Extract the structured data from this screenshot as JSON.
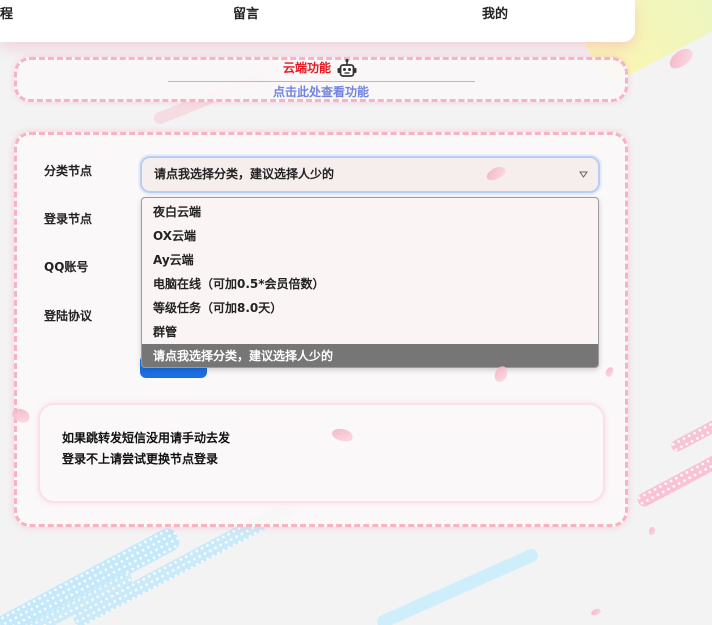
{
  "nav": {
    "items": [
      {
        "label": "程"
      },
      {
        "label": "留言"
      },
      {
        "label": "我的"
      }
    ]
  },
  "cloud_panel": {
    "title": "云端功能",
    "title_icon": "robot-icon",
    "link": "点击此处查看功能"
  },
  "login_form": {
    "labels": {
      "category": "分类节点",
      "node": "登录节点",
      "qq": "QQ账号",
      "protocol": "登陆协议"
    },
    "category_select": {
      "value": "请点我选择分类，建议选择人少的",
      "arrow_icon": "chevron-down-icon",
      "expanded": true,
      "options": [
        "夜白云端",
        "OX云端",
        "Ay云端",
        "电脑在线（可加0.5*会员倍数）",
        "等级任务（可加8.0天）",
        "群管",
        "请点我选择分类，建议选择人少的"
      ],
      "highlighted_index": 6
    }
  },
  "notice": {
    "lines": [
      "如果跳转发短信没用请手动去发",
      "登录不上请尝试更换节点登录"
    ]
  },
  "colors": {
    "title_red": "#e8161e",
    "link_blue": "#7284e0",
    "dashed_border": "#f5b3c3",
    "select_border": "#b7cdf4",
    "select_bg": "#f6eded",
    "dropdown_bg": "#fbf4f4",
    "option_highlight": "#767676",
    "button_blue": "#1c6fe3",
    "text": "#222222"
  }
}
